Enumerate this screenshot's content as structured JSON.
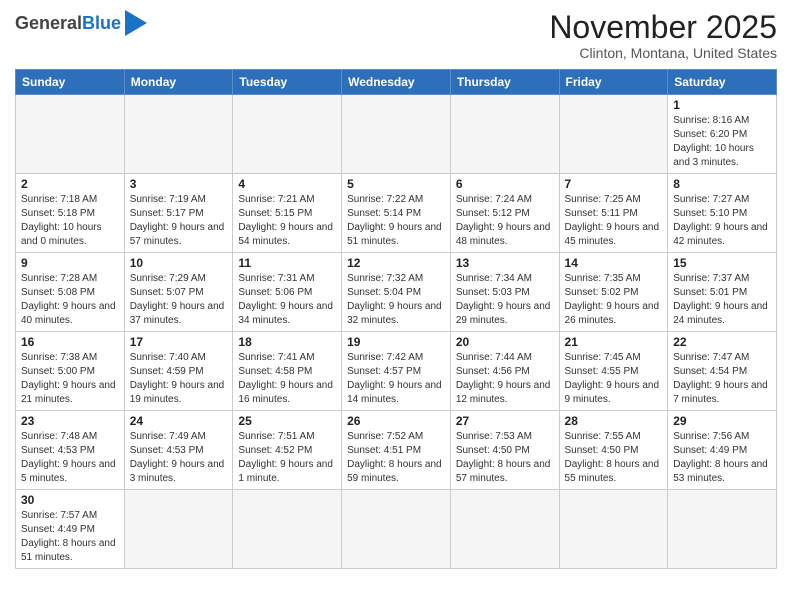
{
  "header": {
    "logo_general": "General",
    "logo_blue": "Blue",
    "month_title": "November 2025",
    "location": "Clinton, Montana, United States"
  },
  "days_of_week": [
    "Sunday",
    "Monday",
    "Tuesday",
    "Wednesday",
    "Thursday",
    "Friday",
    "Saturday"
  ],
  "weeks": [
    [
      {
        "day": "",
        "info": ""
      },
      {
        "day": "",
        "info": ""
      },
      {
        "day": "",
        "info": ""
      },
      {
        "day": "",
        "info": ""
      },
      {
        "day": "",
        "info": ""
      },
      {
        "day": "",
        "info": ""
      },
      {
        "day": "1",
        "info": "Sunrise: 8:16 AM\nSunset: 6:20 PM\nDaylight: 10 hours and 3 minutes."
      }
    ],
    [
      {
        "day": "2",
        "info": "Sunrise: 7:18 AM\nSunset: 5:18 PM\nDaylight: 10 hours and 0 minutes."
      },
      {
        "day": "3",
        "info": "Sunrise: 7:19 AM\nSunset: 5:17 PM\nDaylight: 9 hours and 57 minutes."
      },
      {
        "day": "4",
        "info": "Sunrise: 7:21 AM\nSunset: 5:15 PM\nDaylight: 9 hours and 54 minutes."
      },
      {
        "day": "5",
        "info": "Sunrise: 7:22 AM\nSunset: 5:14 PM\nDaylight: 9 hours and 51 minutes."
      },
      {
        "day": "6",
        "info": "Sunrise: 7:24 AM\nSunset: 5:12 PM\nDaylight: 9 hours and 48 minutes."
      },
      {
        "day": "7",
        "info": "Sunrise: 7:25 AM\nSunset: 5:11 PM\nDaylight: 9 hours and 45 minutes."
      },
      {
        "day": "8",
        "info": "Sunrise: 7:27 AM\nSunset: 5:10 PM\nDaylight: 9 hours and 42 minutes."
      }
    ],
    [
      {
        "day": "9",
        "info": "Sunrise: 7:28 AM\nSunset: 5:08 PM\nDaylight: 9 hours and 40 minutes."
      },
      {
        "day": "10",
        "info": "Sunrise: 7:29 AM\nSunset: 5:07 PM\nDaylight: 9 hours and 37 minutes."
      },
      {
        "day": "11",
        "info": "Sunrise: 7:31 AM\nSunset: 5:06 PM\nDaylight: 9 hours and 34 minutes."
      },
      {
        "day": "12",
        "info": "Sunrise: 7:32 AM\nSunset: 5:04 PM\nDaylight: 9 hours and 32 minutes."
      },
      {
        "day": "13",
        "info": "Sunrise: 7:34 AM\nSunset: 5:03 PM\nDaylight: 9 hours and 29 minutes."
      },
      {
        "day": "14",
        "info": "Sunrise: 7:35 AM\nSunset: 5:02 PM\nDaylight: 9 hours and 26 minutes."
      },
      {
        "day": "15",
        "info": "Sunrise: 7:37 AM\nSunset: 5:01 PM\nDaylight: 9 hours and 24 minutes."
      }
    ],
    [
      {
        "day": "16",
        "info": "Sunrise: 7:38 AM\nSunset: 5:00 PM\nDaylight: 9 hours and 21 minutes."
      },
      {
        "day": "17",
        "info": "Sunrise: 7:40 AM\nSunset: 4:59 PM\nDaylight: 9 hours and 19 minutes."
      },
      {
        "day": "18",
        "info": "Sunrise: 7:41 AM\nSunset: 4:58 PM\nDaylight: 9 hours and 16 minutes."
      },
      {
        "day": "19",
        "info": "Sunrise: 7:42 AM\nSunset: 4:57 PM\nDaylight: 9 hours and 14 minutes."
      },
      {
        "day": "20",
        "info": "Sunrise: 7:44 AM\nSunset: 4:56 PM\nDaylight: 9 hours and 12 minutes."
      },
      {
        "day": "21",
        "info": "Sunrise: 7:45 AM\nSunset: 4:55 PM\nDaylight: 9 hours and 9 minutes."
      },
      {
        "day": "22",
        "info": "Sunrise: 7:47 AM\nSunset: 4:54 PM\nDaylight: 9 hours and 7 minutes."
      }
    ],
    [
      {
        "day": "23",
        "info": "Sunrise: 7:48 AM\nSunset: 4:53 PM\nDaylight: 9 hours and 5 minutes."
      },
      {
        "day": "24",
        "info": "Sunrise: 7:49 AM\nSunset: 4:53 PM\nDaylight: 9 hours and 3 minutes."
      },
      {
        "day": "25",
        "info": "Sunrise: 7:51 AM\nSunset: 4:52 PM\nDaylight: 9 hours and 1 minute."
      },
      {
        "day": "26",
        "info": "Sunrise: 7:52 AM\nSunset: 4:51 PM\nDaylight: 8 hours and 59 minutes."
      },
      {
        "day": "27",
        "info": "Sunrise: 7:53 AM\nSunset: 4:50 PM\nDaylight: 8 hours and 57 minutes."
      },
      {
        "day": "28",
        "info": "Sunrise: 7:55 AM\nSunset: 4:50 PM\nDaylight: 8 hours and 55 minutes."
      },
      {
        "day": "29",
        "info": "Sunrise: 7:56 AM\nSunset: 4:49 PM\nDaylight: 8 hours and 53 minutes."
      }
    ],
    [
      {
        "day": "30",
        "info": "Sunrise: 7:57 AM\nSunset: 4:49 PM\nDaylight: 8 hours and 51 minutes."
      },
      {
        "day": "",
        "info": ""
      },
      {
        "day": "",
        "info": ""
      },
      {
        "day": "",
        "info": ""
      },
      {
        "day": "",
        "info": ""
      },
      {
        "day": "",
        "info": ""
      },
      {
        "day": "",
        "info": ""
      }
    ]
  ]
}
